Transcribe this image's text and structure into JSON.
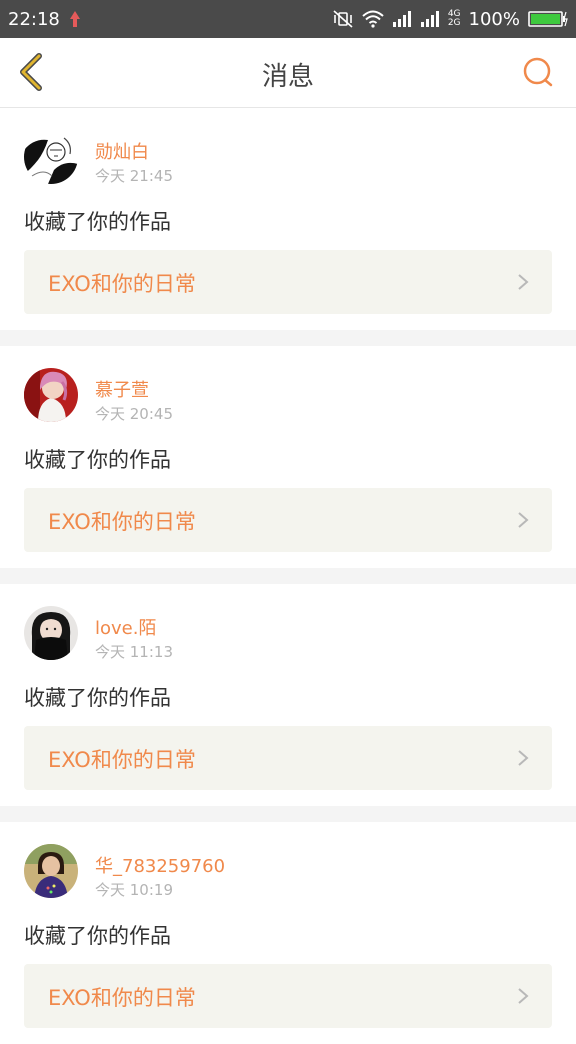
{
  "status_bar": {
    "time": "22:18",
    "network": "4G\n2G",
    "battery": "100%"
  },
  "header": {
    "title": "消息"
  },
  "colors": {
    "accent": "#f0894b",
    "status_bar_bg": "#4a4a4a",
    "back_icon": "#e0b530",
    "card_bg": "#f4f4ee",
    "divider": "#f4f4f4"
  },
  "messages": [
    {
      "user": "勋灿白",
      "time": "今天 21:45",
      "action": "收藏了你的作品",
      "work": "EXO和你的日常",
      "avatar_icon": "avatar-sketch"
    },
    {
      "user": "慕子萱",
      "time": "今天 20:45",
      "action": "收藏了你的作品",
      "work": "EXO和你的日常",
      "avatar_icon": "avatar-pink-hair"
    },
    {
      "user": "love.陌",
      "time": "今天 11:13",
      "action": "收藏了你的作品",
      "work": "EXO和你的日常",
      "avatar_icon": "avatar-girl-dark"
    },
    {
      "user": "华_783259760",
      "time": "今天 10:19",
      "action": "收藏了你的作品",
      "work": "EXO和你的日常",
      "avatar_icon": "avatar-girl-photo"
    }
  ]
}
